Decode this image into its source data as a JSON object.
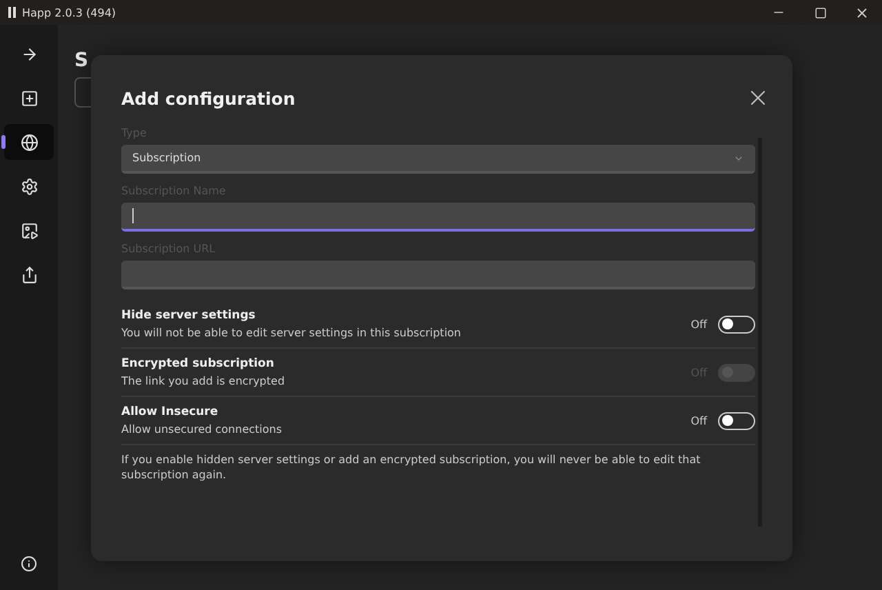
{
  "window": {
    "title": "Happ 2.0.3 (494)"
  },
  "sidebar": {
    "items": [
      {
        "selected": false
      },
      {
        "selected": false
      },
      {
        "selected": true
      },
      {
        "selected": false
      },
      {
        "selected": false
      },
      {
        "selected": false
      }
    ]
  },
  "page": {
    "title": "S"
  },
  "dialog": {
    "title": "Add configuration",
    "fields": [
      {
        "kind": "select",
        "label": "Type",
        "value": "Subscription",
        "focused": false
      },
      {
        "kind": "text",
        "label": "Subscription Name",
        "focused": true
      },
      {
        "kind": "text",
        "label": "Subscription URL",
        "focused": false
      }
    ],
    "toggles": [
      {
        "title": "Hide server settings",
        "description": "You will not be able to edit server settings in this subscription",
        "state_label": "Off",
        "on": false,
        "disabled": false
      },
      {
        "title": "Encrypted subscription",
        "description": "The link you add is encrypted",
        "state_label": "Off",
        "on": false,
        "disabled": true
      },
      {
        "title": "Allow Insecure",
        "description": "Allow unsecured connections",
        "state_label": "Off",
        "on": false,
        "disabled": false
      }
    ],
    "note": "If you enable hidden server settings or add an encrypted subscription, you will never be able to edit that subscription again."
  }
}
